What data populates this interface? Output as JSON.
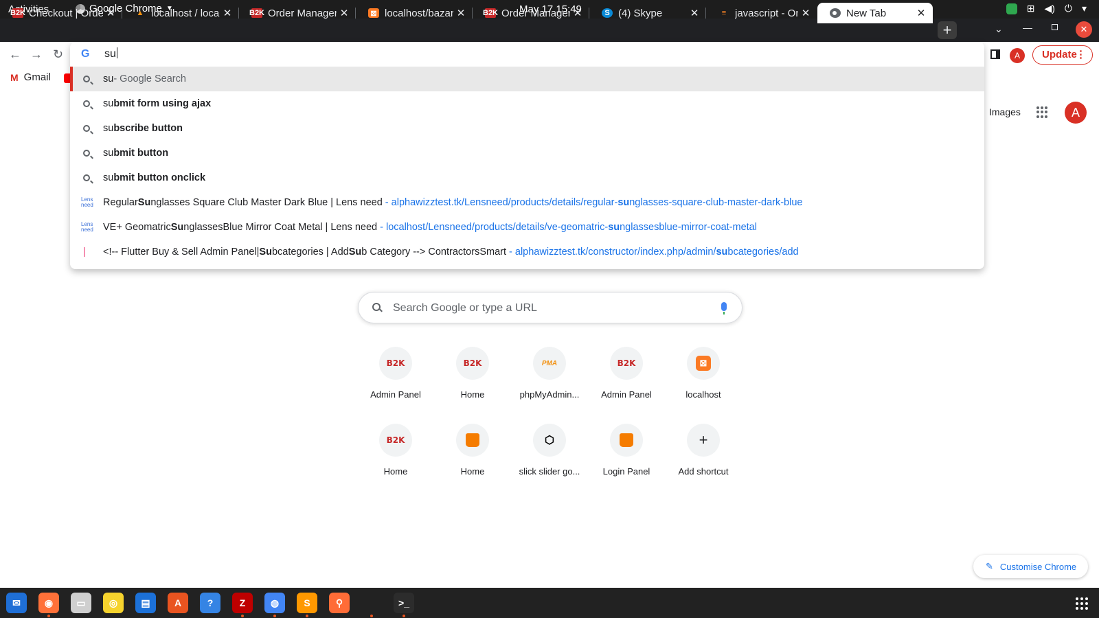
{
  "topbar": {
    "activities": "Activities",
    "app_name": "Google Chrome",
    "clock": "May 17  15:49"
  },
  "tabs": [
    {
      "title": "Checkout | Order",
      "favicon": "b2k-logo"
    },
    {
      "title": "localhost / localhost",
      "favicon": "phpmyadmin-logo"
    },
    {
      "title": "Order Manager",
      "favicon": "b2k-logo"
    },
    {
      "title": "localhost/bazar",
      "favicon": "xampp-logo"
    },
    {
      "title": "Order Manager",
      "favicon": "b2k-logo"
    },
    {
      "title": "(4) Skype",
      "favicon": "skype-logo"
    },
    {
      "title": "javascript - OnC",
      "favicon": "stackoverflow-logo"
    },
    {
      "title": "New Tab",
      "favicon": "newtab-icon",
      "active": true
    }
  ],
  "toolbar": {
    "update_label": "Update",
    "avatar_letter": "A"
  },
  "bookmarks": {
    "gmail_label": "Gmail"
  },
  "omnibox": {
    "typed": "su",
    "suggestions": [
      {
        "kind": "search",
        "bold_prefix": "su",
        "rest": " - Google Search",
        "selected": true
      },
      {
        "kind": "search",
        "typed_part": "su",
        "bold_rest": "bmit form using ajax"
      },
      {
        "kind": "search",
        "typed_part": "su",
        "bold_rest": "bscribe button"
      },
      {
        "kind": "search",
        "typed_part": "su",
        "bold_rest": "bmit button"
      },
      {
        "kind": "search",
        "typed_part": "su",
        "bold_rest": "bmit button onclick"
      },
      {
        "kind": "history",
        "favicon": "lens-need-logo",
        "title_pre": "Regular ",
        "title_bold": "Su",
        "title_post": "nglasses Square Club Master Dark Blue | Lens need",
        "url_pre": "alphawizztest.tk/Lensneed/products/details/regular-",
        "url_bold": "su",
        "url_post": "nglasses-square-club-master-dark-blue"
      },
      {
        "kind": "history",
        "favicon": "lens-need-logo",
        "title_pre": "VE+ Geomatric ",
        "title_bold": "Su",
        "title_post": "nglassesBlue Mirror Coat Metal | Lens need",
        "url_pre": "localhost/Lensneed/products/details/ve-geomatric-",
        "url_bold": "su",
        "url_post": "nglassesblue-mirror-coat-metal"
      },
      {
        "kind": "history",
        "favicon": "contractors-logo",
        "title_pre": "<!-- Flutter Buy & Sell Admin Panel|",
        "title_bold": "Su",
        "title_mid": "bcategories | Add ",
        "title_bold2": "Su",
        "title_post": "b Category --> ContractorsSmart",
        "url_pre": "alphawizztest.tk/constructor/index.php/admin/",
        "url_bold": "su",
        "url_post": "bcategories/add"
      }
    ]
  },
  "ntp": {
    "images_link": "Images",
    "avatar_letter": "A",
    "search_placeholder": "Search Google or type a URL",
    "shortcuts": [
      {
        "label": "Admin Panel",
        "icon": "b2k-logo",
        "glyph": "B2K"
      },
      {
        "label": "Home",
        "icon": "b2k-logo",
        "glyph": "B2K"
      },
      {
        "label": "phpMyAdmin...",
        "icon": "phpmyadmin-logo",
        "glyph": "PMA"
      },
      {
        "label": "Admin Panel",
        "icon": "b2k-logo",
        "glyph": "B2K"
      },
      {
        "label": "localhost",
        "icon": "xampp-logo",
        "glyph": "⊠"
      },
      {
        "label": "Home",
        "icon": "b2k-logo",
        "glyph": "B2K"
      },
      {
        "label": "Home",
        "icon": "shopping-bag-icon",
        "glyph": ""
      },
      {
        "label": "slick slider go...",
        "icon": "codepen-icon",
        "glyph": "⬡"
      },
      {
        "label": "Login Panel",
        "icon": "shopping-bag-icon",
        "glyph": ""
      },
      {
        "label": "Add shortcut",
        "icon": "plus-icon",
        "glyph": "+"
      }
    ],
    "customise_label": "Customise Chrome"
  },
  "dock": [
    {
      "name": "thunderbird-icon",
      "color": "#1f6fd6",
      "running": false
    },
    {
      "name": "firefox-icon",
      "color": "#ff7139",
      "running": true
    },
    {
      "name": "files-icon",
      "color": "#cfcfcf",
      "running": false
    },
    {
      "name": "rhythmbox-icon",
      "color": "#f6d32d",
      "running": false
    },
    {
      "name": "writer-icon",
      "color": "#1c71d8",
      "running": false
    },
    {
      "name": "software-icon",
      "color": "#e95420",
      "running": false
    },
    {
      "name": "help-icon",
      "color": "#3584e4",
      "running": false
    },
    {
      "name": "filezilla-icon",
      "color": "#bf0000",
      "running": true
    },
    {
      "name": "chrome-icon",
      "color": "#4285f4",
      "running": true
    },
    {
      "name": "sublime-icon",
      "color": "#ff9800",
      "running": true
    },
    {
      "name": "postman-icon",
      "color": "#ff6c37",
      "running": false
    },
    {
      "name": "blank-app-icon",
      "color": "#222222",
      "running": true
    },
    {
      "name": "terminal-icon",
      "color": "#2c2c2c",
      "running": true
    }
  ]
}
